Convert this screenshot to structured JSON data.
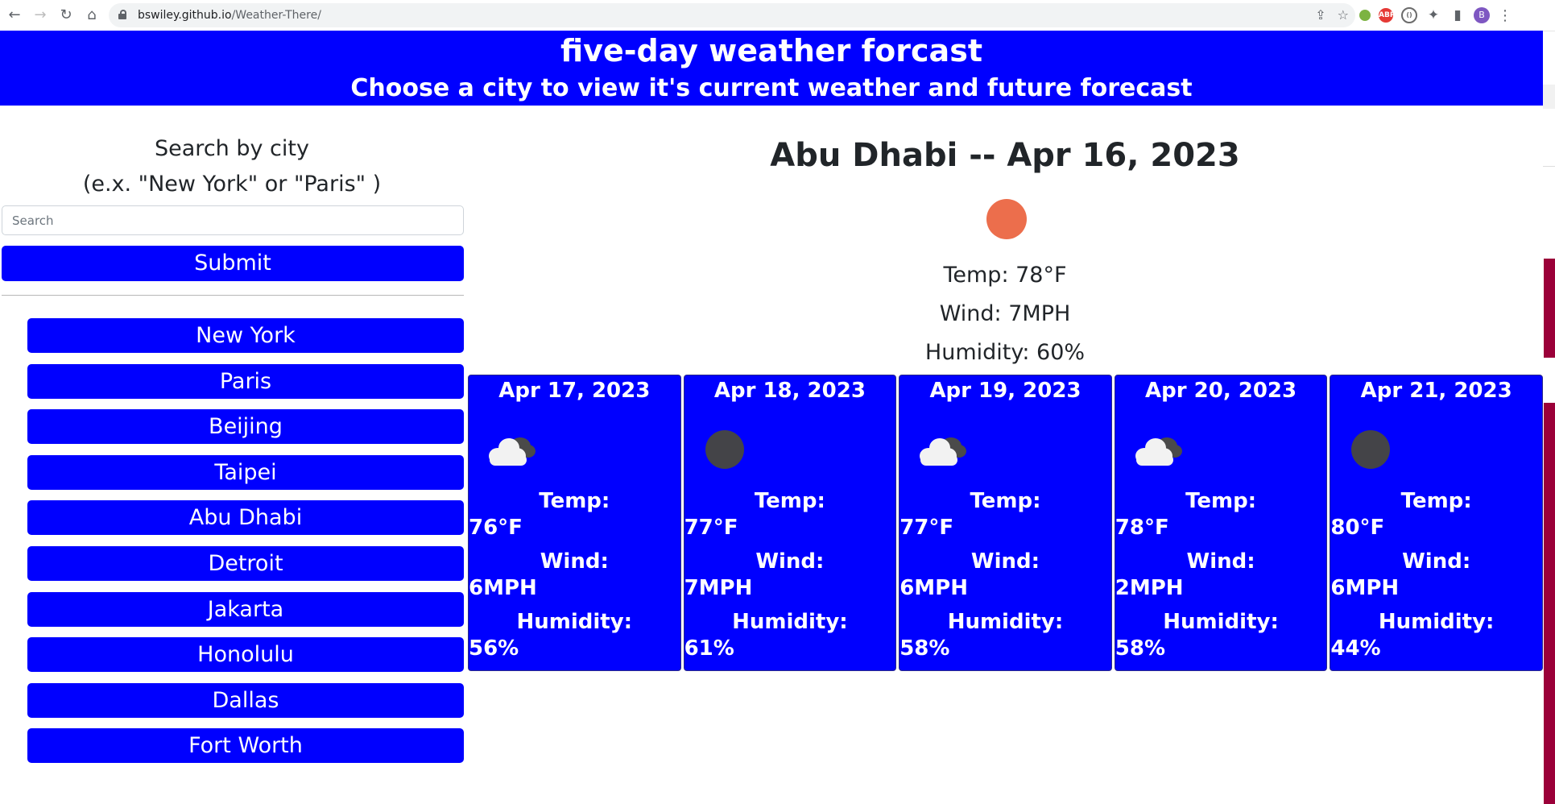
{
  "browser": {
    "url_host": "bswiley.github.io",
    "url_path": "/Weather-There/",
    "profile_initial": "B",
    "abp_label": "ABP"
  },
  "header": {
    "title": "five-day weather forcast",
    "subtitle": "Choose a city to view it's current weather and future forecast"
  },
  "search": {
    "title": "Search by city",
    "hint": "(e.x. \"New York\" or \"Paris\" )",
    "placeholder": "Search",
    "submit_label": "Submit"
  },
  "cities": [
    "New York",
    "Paris",
    "Beijing",
    "Taipei",
    "Abu Dhabi",
    "Detroit",
    "Jakarta",
    "Honolulu",
    "Dallas",
    "Fort Worth"
  ],
  "current": {
    "title": "Abu Dhabi -- Apr 16, 2023",
    "icon": "sun-icon",
    "icon_color": "#ec6e4c",
    "temp": "Temp: 78°F",
    "wind": "Wind: 7MPH",
    "humidity": "Humidity: 60%"
  },
  "labels": {
    "temp": "Temp:",
    "wind": "Wind:",
    "humidity": "Humidity:"
  },
  "forecast": [
    {
      "date": "Apr 17, 2023",
      "icon": "cloud-icon",
      "temp": "76°F",
      "wind": "6MPH",
      "humidity": "56%"
    },
    {
      "date": "Apr 18, 2023",
      "icon": "moon-icon",
      "temp": "77°F",
      "wind": "7MPH",
      "humidity": "61%"
    },
    {
      "date": "Apr 19, 2023",
      "icon": "cloud-icon",
      "temp": "77°F",
      "wind": "6MPH",
      "humidity": "58%"
    },
    {
      "date": "Apr 20, 2023",
      "icon": "cloud-icon",
      "temp": "78°F",
      "wind": "2MPH",
      "humidity": "58%"
    },
    {
      "date": "Apr 21, 2023",
      "icon": "moon-icon",
      "temp": "80°F",
      "wind": "6MPH",
      "humidity": "44%"
    }
  ],
  "colors": {
    "accent": "#0000ff",
    "sun": "#ec6e4c",
    "dark_icon": "#444448"
  }
}
